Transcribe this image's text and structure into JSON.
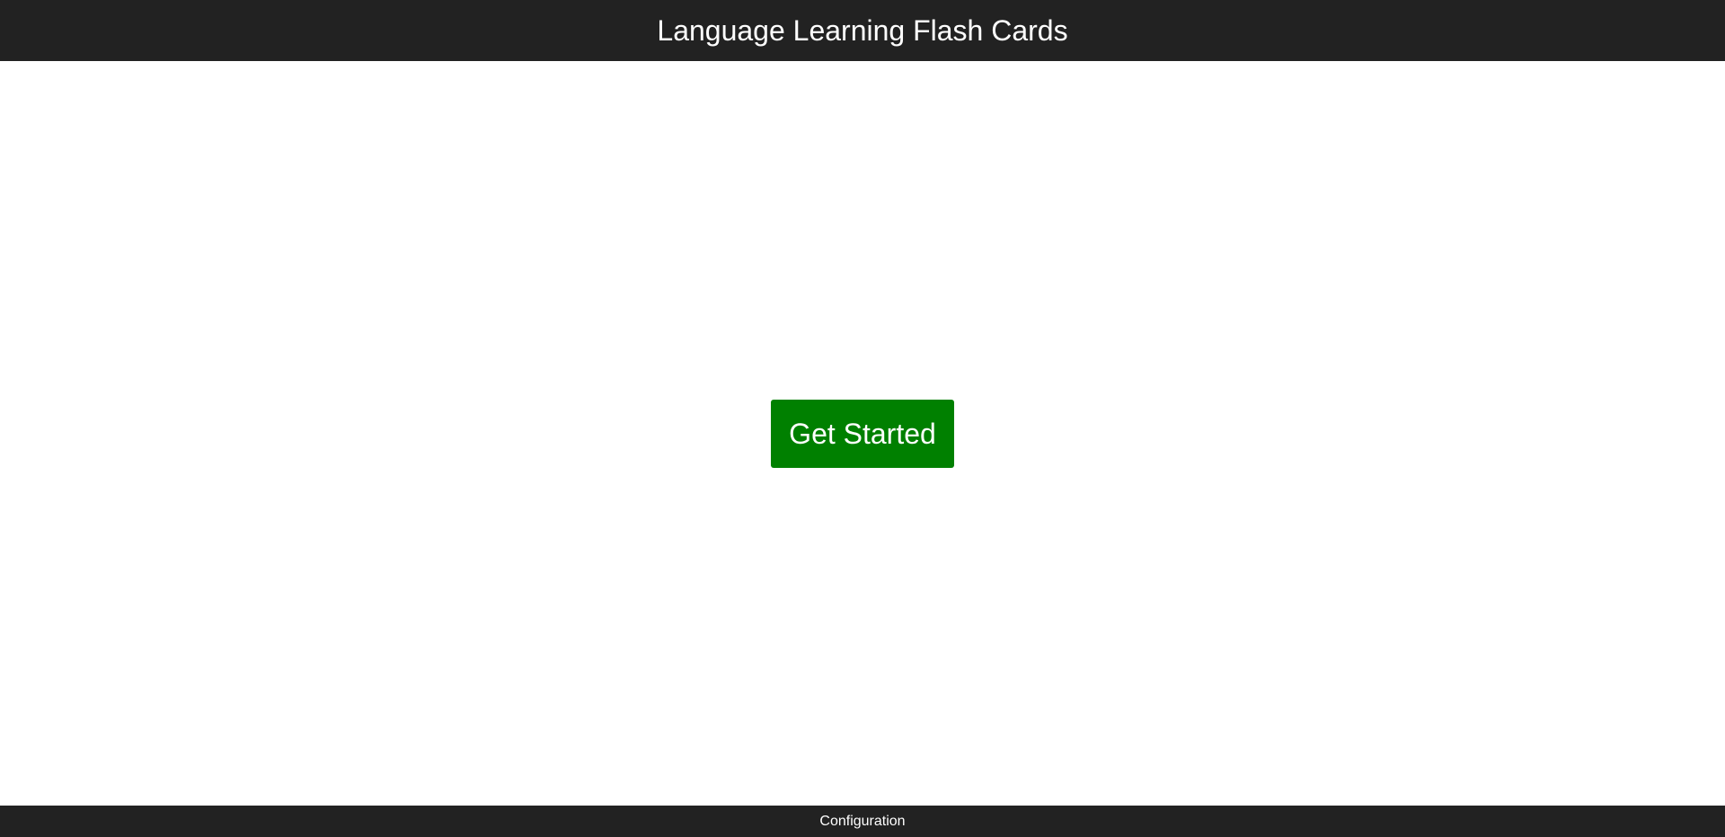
{
  "header": {
    "title": "Language Learning Flash Cards"
  },
  "main": {
    "start_button_label": "Get Started"
  },
  "footer": {
    "config_label": "Configuration"
  },
  "colors": {
    "header_bg": "#222222",
    "footer_bg": "#222222",
    "button_bg": "#008000",
    "text_light": "#ffffff",
    "page_bg": "#ffffff"
  }
}
